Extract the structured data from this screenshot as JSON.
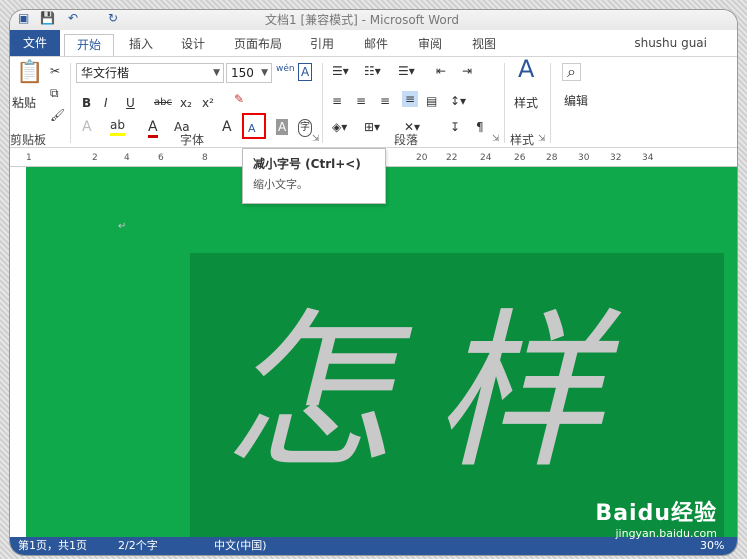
{
  "window": {
    "title": "文档1 [兼容模式] - Microsoft Word"
  },
  "tabs": {
    "file": "文件",
    "items": [
      "开始",
      "插入",
      "设计",
      "页面布局",
      "引用",
      "邮件",
      "审阅",
      "视图"
    ],
    "active_index": 0
  },
  "user": "shushu guai",
  "ribbon": {
    "clipboard": {
      "paste_label": "粘贴",
      "group_label": "剪贴板"
    },
    "font": {
      "font_name": "华文行楷",
      "font_size": "150",
      "group_label": "字体",
      "buttons": {
        "bold": "B",
        "italic": "I",
        "underline": "U",
        "strike": "abc",
        "subscript": "x₂",
        "superscript": "x²",
        "grow": "A",
        "shrink": "A",
        "case": "Aa",
        "text_effect": "A",
        "font_color": "A",
        "char_shading": "A",
        "enclosed": "字",
        "phonetic": "wén"
      }
    },
    "paragraph": {
      "group_label": "段落"
    },
    "styles": {
      "label": "样式",
      "group_label": "样式"
    },
    "editing": {
      "label": "编辑"
    }
  },
  "ruler": {
    "ticks": [
      "1",
      "2",
      "4",
      "6",
      "8",
      "10",
      "12",
      "14",
      "16",
      "18",
      "20",
      "22",
      "24",
      "26",
      "28",
      "30",
      "32",
      "34"
    ]
  },
  "tooltip": {
    "title": "减小字号 (Ctrl+<)",
    "desc": "缩小文字。"
  },
  "document": {
    "text": "怎样"
  },
  "status": {
    "page": "第1页，共1页",
    "words": "2/2个字",
    "lang": "中文(中国)",
    "zoom": "30%"
  },
  "watermark": {
    "logo": "Baidu经验",
    "url": "jingyan.baidu.com"
  },
  "colors": {
    "accent": "#2b579a",
    "doc_bg": "#0fa84a",
    "doc_inner": "#0a8d3d",
    "highlight": "#e00000"
  }
}
